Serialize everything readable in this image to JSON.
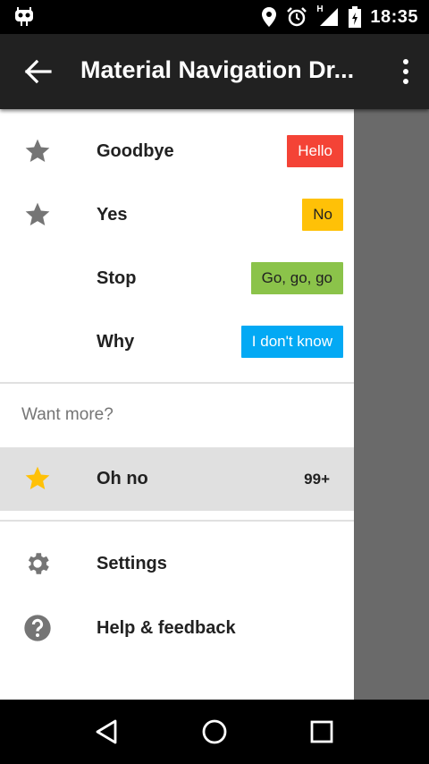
{
  "status": {
    "time": "18:35",
    "network": "H"
  },
  "toolbar": {
    "title": "Material Navigation Dr..."
  },
  "drawer": {
    "items": [
      {
        "label": "Goodbye",
        "badge": "Hello",
        "badge_color": "#F44336"
      },
      {
        "label": "Yes",
        "badge": "No",
        "badge_color": "#FFC107"
      },
      {
        "label": "Stop",
        "badge": "Go, go, go",
        "badge_color": "#8BC34A"
      },
      {
        "label": "Why",
        "badge": "I don't know",
        "badge_color": "#03A9F4"
      }
    ],
    "subheader": "Want more?",
    "active_item": {
      "label": "Oh no",
      "count": "99+",
      "icon_color": "#FFC107"
    },
    "bottom_items": [
      {
        "label": "Settings"
      },
      {
        "label": "Help & feedback"
      }
    ]
  },
  "colors": {
    "icon_gray": "#757575",
    "toolbar": "#212121"
  }
}
